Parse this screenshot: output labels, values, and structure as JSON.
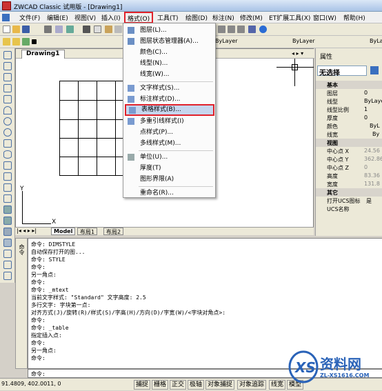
{
  "title": "ZWCAD Classic 试用版 - [Drawing1]",
  "menu": [
    "文件(F)",
    "编辑(E)",
    "视图(V)",
    "插入(I)",
    "格式(O)",
    "工具(T)",
    "绘图(D)",
    "标注(N)",
    "修改(M)",
    "ET扩展工具(X)",
    "窗口(W)",
    "帮助(H)"
  ],
  "toolbar2": {
    "bylayer1": "ByLayer",
    "bylayer2": "ByLayer",
    "bylayer3": "ByLaye"
  },
  "doc_tab": "Drawing1",
  "layout_tabs": [
    "Model",
    "布局1",
    "布局2"
  ],
  "dropdown_items": [
    "图层(L)...",
    "图层状态管理器(A)...",
    "颜色(C)...",
    "线型(N)...",
    "线宽(W)...",
    "文字样式(S)...",
    "标注样式(D)...",
    "表格样式(B)...",
    "多重引线样式(I)",
    "点样式(P)...",
    "多线样式(M)...",
    "单位(U)...",
    "厚度(T)",
    "图形界限(A)",
    "重命名(R)..."
  ],
  "properties": {
    "title": "属性",
    "selection": "无选择",
    "rows": [
      [
        "基本",
        ""
      ],
      [
        "图层",
        "0"
      ],
      [
        "线型",
        "ByLayer"
      ],
      [
        "线型比例",
        "1"
      ],
      [
        "厚度",
        "0"
      ],
      [
        "颜色",
        "ByL"
      ],
      [
        "线宽",
        "By"
      ],
      [
        "视图",
        ""
      ],
      [
        "中心点 X",
        "24.56"
      ],
      [
        "中心点 Y",
        "362.86"
      ],
      [
        "中心点 Z",
        "0"
      ],
      [
        "高度",
        "83.36"
      ],
      [
        "宽度",
        "131.8"
      ],
      [
        "其它",
        ""
      ],
      [
        "打开UCS图标",
        "是"
      ],
      [
        "UCS名称",
        ""
      ]
    ]
  },
  "command_lines": [
    "命令: DIMSTYLE",
    "自动保存打开的图...",
    "命令: STYLE",
    "命令:",
    "另一角点:",
    "命令:",
    "命令: _mtext",
    "当前文字样式: \"Standard\" 文字高度: 2.5",
    "多行文字: 字块第一点:",
    "对齐方式(J)/旋转(R)/样式(S)/字高(H)/方向(D)/字宽(W)/<字块对角点>:",
    "命令:",
    "命令: _table",
    "指定插入点:",
    "命令:",
    "另一角点:",
    "命令:"
  ],
  "command_prompt": "命令:",
  "cmd_side_label": "命令",
  "status": {
    "coords": "91.4809, 402.0011, 0",
    "buttons": [
      "捕捉",
      "栅格",
      "正交",
      "极轴",
      "对象捕捉",
      "对象追踪",
      "线宽",
      "模型"
    ]
  },
  "axis": {
    "x": "X",
    "y": "Y"
  },
  "watermark": {
    "brand": "资料网",
    "url": "ZL-XS1616.COM"
  }
}
